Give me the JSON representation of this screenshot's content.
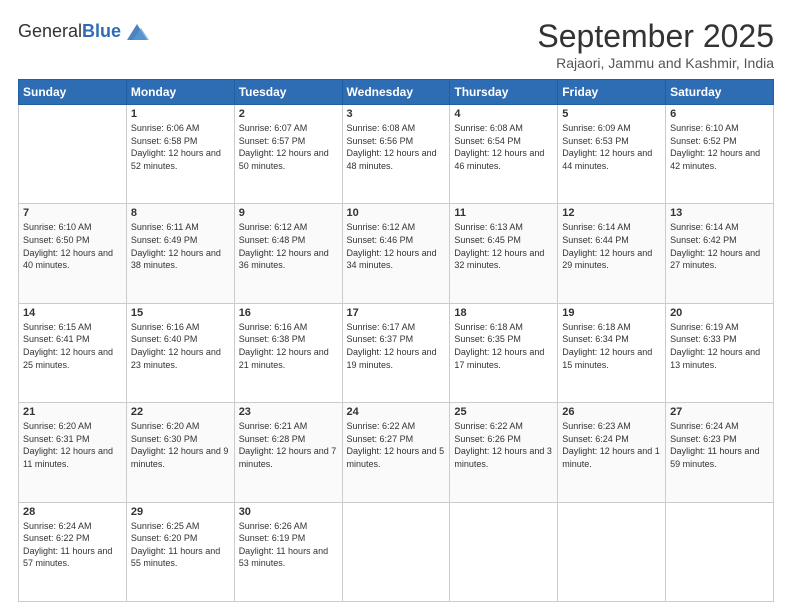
{
  "header": {
    "logo_general": "General",
    "logo_blue": "Blue",
    "month_title": "September 2025",
    "location": "Rajaori, Jammu and Kashmir, India"
  },
  "days_of_week": [
    "Sunday",
    "Monday",
    "Tuesday",
    "Wednesday",
    "Thursday",
    "Friday",
    "Saturday"
  ],
  "weeks": [
    [
      {
        "day": "",
        "empty": true
      },
      {
        "day": "1",
        "sunrise": "6:06 AM",
        "sunset": "6:58 PM",
        "daylight": "12 hours and 52 minutes."
      },
      {
        "day": "2",
        "sunrise": "6:07 AM",
        "sunset": "6:57 PM",
        "daylight": "12 hours and 50 minutes."
      },
      {
        "day": "3",
        "sunrise": "6:08 AM",
        "sunset": "6:56 PM",
        "daylight": "12 hours and 48 minutes."
      },
      {
        "day": "4",
        "sunrise": "6:08 AM",
        "sunset": "6:54 PM",
        "daylight": "12 hours and 46 minutes."
      },
      {
        "day": "5",
        "sunrise": "6:09 AM",
        "sunset": "6:53 PM",
        "daylight": "12 hours and 44 minutes."
      },
      {
        "day": "6",
        "sunrise": "6:10 AM",
        "sunset": "6:52 PM",
        "daylight": "12 hours and 42 minutes."
      }
    ],
    [
      {
        "day": "7",
        "sunrise": "6:10 AM",
        "sunset": "6:50 PM",
        "daylight": "12 hours and 40 minutes."
      },
      {
        "day": "8",
        "sunrise": "6:11 AM",
        "sunset": "6:49 PM",
        "daylight": "12 hours and 38 minutes."
      },
      {
        "day": "9",
        "sunrise": "6:12 AM",
        "sunset": "6:48 PM",
        "daylight": "12 hours and 36 minutes."
      },
      {
        "day": "10",
        "sunrise": "6:12 AM",
        "sunset": "6:46 PM",
        "daylight": "12 hours and 34 minutes."
      },
      {
        "day": "11",
        "sunrise": "6:13 AM",
        "sunset": "6:45 PM",
        "daylight": "12 hours and 32 minutes."
      },
      {
        "day": "12",
        "sunrise": "6:14 AM",
        "sunset": "6:44 PM",
        "daylight": "12 hours and 29 minutes."
      },
      {
        "day": "13",
        "sunrise": "6:14 AM",
        "sunset": "6:42 PM",
        "daylight": "12 hours and 27 minutes."
      }
    ],
    [
      {
        "day": "14",
        "sunrise": "6:15 AM",
        "sunset": "6:41 PM",
        "daylight": "12 hours and 25 minutes."
      },
      {
        "day": "15",
        "sunrise": "6:16 AM",
        "sunset": "6:40 PM",
        "daylight": "12 hours and 23 minutes."
      },
      {
        "day": "16",
        "sunrise": "6:16 AM",
        "sunset": "6:38 PM",
        "daylight": "12 hours and 21 minutes."
      },
      {
        "day": "17",
        "sunrise": "6:17 AM",
        "sunset": "6:37 PM",
        "daylight": "12 hours and 19 minutes."
      },
      {
        "day": "18",
        "sunrise": "6:18 AM",
        "sunset": "6:35 PM",
        "daylight": "12 hours and 17 minutes."
      },
      {
        "day": "19",
        "sunrise": "6:18 AM",
        "sunset": "6:34 PM",
        "daylight": "12 hours and 15 minutes."
      },
      {
        "day": "20",
        "sunrise": "6:19 AM",
        "sunset": "6:33 PM",
        "daylight": "12 hours and 13 minutes."
      }
    ],
    [
      {
        "day": "21",
        "sunrise": "6:20 AM",
        "sunset": "6:31 PM",
        "daylight": "12 hours and 11 minutes."
      },
      {
        "day": "22",
        "sunrise": "6:20 AM",
        "sunset": "6:30 PM",
        "daylight": "12 hours and 9 minutes."
      },
      {
        "day": "23",
        "sunrise": "6:21 AM",
        "sunset": "6:28 PM",
        "daylight": "12 hours and 7 minutes."
      },
      {
        "day": "24",
        "sunrise": "6:22 AM",
        "sunset": "6:27 PM",
        "daylight": "12 hours and 5 minutes."
      },
      {
        "day": "25",
        "sunrise": "6:22 AM",
        "sunset": "6:26 PM",
        "daylight": "12 hours and 3 minutes."
      },
      {
        "day": "26",
        "sunrise": "6:23 AM",
        "sunset": "6:24 PM",
        "daylight": "12 hours and 1 minute."
      },
      {
        "day": "27",
        "sunrise": "6:24 AM",
        "sunset": "6:23 PM",
        "daylight": "11 hours and 59 minutes."
      }
    ],
    [
      {
        "day": "28",
        "sunrise": "6:24 AM",
        "sunset": "6:22 PM",
        "daylight": "11 hours and 57 minutes."
      },
      {
        "day": "29",
        "sunrise": "6:25 AM",
        "sunset": "6:20 PM",
        "daylight": "11 hours and 55 minutes."
      },
      {
        "day": "30",
        "sunrise": "6:26 AM",
        "sunset": "6:19 PM",
        "daylight": "11 hours and 53 minutes."
      },
      {
        "day": "",
        "empty": true
      },
      {
        "day": "",
        "empty": true
      },
      {
        "day": "",
        "empty": true
      },
      {
        "day": "",
        "empty": true
      }
    ]
  ],
  "labels": {
    "sunrise": "Sunrise:",
    "sunset": "Sunset:",
    "daylight": "Daylight:"
  }
}
